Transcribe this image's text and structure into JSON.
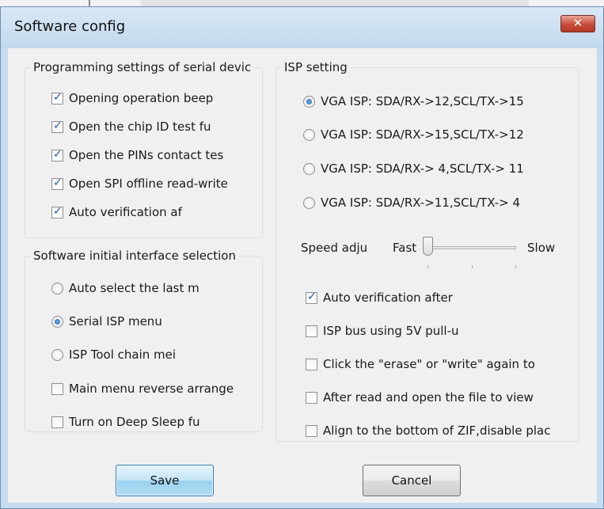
{
  "window": {
    "title": "Software config",
    "close_label": "✕"
  },
  "group_serial": {
    "legend": "Programming settings of serial devic",
    "items": [
      {
        "label": "Opening operation beep",
        "checked": true
      },
      {
        "label": "Open the chip ID test fu",
        "checked": true
      },
      {
        "label": "Open the PINs contact tes",
        "checked": true
      },
      {
        "label": "Open SPI offline read-write",
        "checked": true
      },
      {
        "label": "Auto verification af",
        "checked": true
      }
    ]
  },
  "group_initial": {
    "legend": "Software initial interface selection",
    "radios": [
      {
        "label": "Auto select the last m",
        "selected": false
      },
      {
        "label": "Serial ISP menu",
        "selected": true
      },
      {
        "label": "ISP Tool chain mei",
        "selected": false
      }
    ],
    "checks": [
      {
        "label": "Main menu reverse arrange",
        "checked": false
      },
      {
        "label": "Turn on Deep Sleep fu",
        "checked": false
      }
    ]
  },
  "group_isp": {
    "legend": "ISP setting",
    "radios": [
      {
        "label": "VGA ISP: SDA/RX->12,SCL/TX->15",
        "selected": true
      },
      {
        "label": "VGA ISP: SDA/RX->15,SCL/TX->12",
        "selected": false
      },
      {
        "label": "VGA ISP: SDA/RX-> 4,SCL/TX-> 11",
        "selected": false
      },
      {
        "label": "VGA ISP: SDA/RX->11,SCL/TX-> 4",
        "selected": false
      }
    ],
    "speed": {
      "label": "Speed adjustment:",
      "fast_label": "Fast",
      "slow_label": "Slow",
      "value": 0
    },
    "checks": [
      {
        "label": "Auto verification after",
        "checked": true
      },
      {
        "label": "ISP bus using 5V pull-u",
        "checked": false
      },
      {
        "label": "Click the \"erase\" or \"write\" again to",
        "checked": false
      },
      {
        "label": "After read and open the file to view",
        "checked": false
      },
      {
        "label": "Align to the bottom of ZIF,disable plac",
        "checked": false
      }
    ]
  },
  "buttons": {
    "save": "Save",
    "cancel": "Cancel"
  }
}
